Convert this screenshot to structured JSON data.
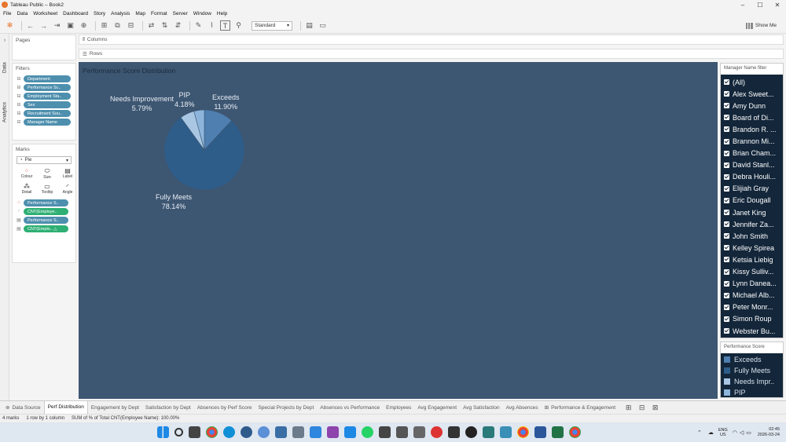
{
  "window": {
    "title": "Tableau Public – Book2",
    "controls": [
      "–",
      "☐",
      "✕"
    ]
  },
  "menu": [
    "File",
    "Data",
    "Worksheet",
    "Dashboard",
    "Story",
    "Analysis",
    "Map",
    "Format",
    "Server",
    "Window",
    "Help"
  ],
  "toolbar": {
    "fit": "Standard",
    "show_me": "Show Me"
  },
  "side_tabs": [
    "Data",
    "Analytics"
  ],
  "pages_label": "Pages",
  "shelves": {
    "columns": "Columns",
    "rows": "Rows"
  },
  "filters": {
    "title": "Filters",
    "items": [
      "Department",
      "Performance Sc..",
      "Employment Sta..",
      "Sex",
      "Recruitment Sou..",
      "Manager Name"
    ]
  },
  "marks": {
    "title": "Marks",
    "type": "Pie",
    "buttons": [
      "Colour",
      "Size",
      "Label",
      "Detail",
      "Tooltip",
      "Angle"
    ],
    "fields": [
      "Performance S..",
      "CNT(Employe..",
      "Performance S..",
      "CNT(Emplo.. △"
    ]
  },
  "chart_title": "Performance Score Distribution",
  "chart_data": {
    "type": "pie",
    "title": "Performance Score Distribution",
    "slices": [
      {
        "name": "Exceeds",
        "value": 11.9,
        "label": "11.90%",
        "color": "#4f7fb0"
      },
      {
        "name": "Fully Meets",
        "value": 78.14,
        "label": "78.14%",
        "color": "#2e5d8a"
      },
      {
        "name": "Needs Improvement",
        "value": 5.79,
        "label": "5.79%",
        "color": "#a9c7e3"
      },
      {
        "name": "PIP",
        "value": 4.18,
        "label": "4.18%",
        "color": "#8db5dc"
      }
    ]
  },
  "manager_filter": {
    "title": "Manager Name filter",
    "items": [
      "(All)",
      "Alex Sweet...",
      "Amy Dunn",
      "Board of Di...",
      "Brandon R. ...",
      "Brannon Mi...",
      "Brian Cham...",
      "David Stanl...",
      "Debra Houli...",
      "Elijiah Gray",
      "Eric Dougall",
      "Janet King",
      "Jennifer Za...",
      "John Smith",
      "Kelley Spirea",
      "Ketsia Liebig",
      "Kissy Sulliv...",
      "Lynn Danea...",
      "Michael Alb...",
      "Peter Monr...",
      "Simon Roup",
      "Webster Bu..."
    ]
  },
  "legend": {
    "title": "Performance Score",
    "items": [
      {
        "label": "Exceeds",
        "color": "#4f7fb0"
      },
      {
        "label": "Fully Meets",
        "color": "#2e5d8a"
      },
      {
        "label": "Needs Impr..",
        "color": "#a9c7e3"
      },
      {
        "label": "PIP",
        "color": "#8db5dc"
      }
    ]
  },
  "sheet_tabs": [
    "Data Source",
    "Perf Distribution",
    "Engagement by Dept",
    "Satisfaction by Dept",
    "Absences by Perf Score",
    "Special Projects by Dept",
    "Absences vs Performance",
    "Employees",
    "Avg Engagement",
    "Avg Satisfaction",
    "Avg Absences",
    "Performance & Engagement"
  ],
  "active_sheet": "Perf Distribution",
  "status": {
    "marks": "4 marks",
    "dims": "1 row by 1 column",
    "sum": "SUM of % of Total CNT(Employee Name): 100.00%"
  },
  "tray": {
    "lang": "ENG",
    "region": "US",
    "time": "02:45",
    "date": "2026-03-24"
  }
}
